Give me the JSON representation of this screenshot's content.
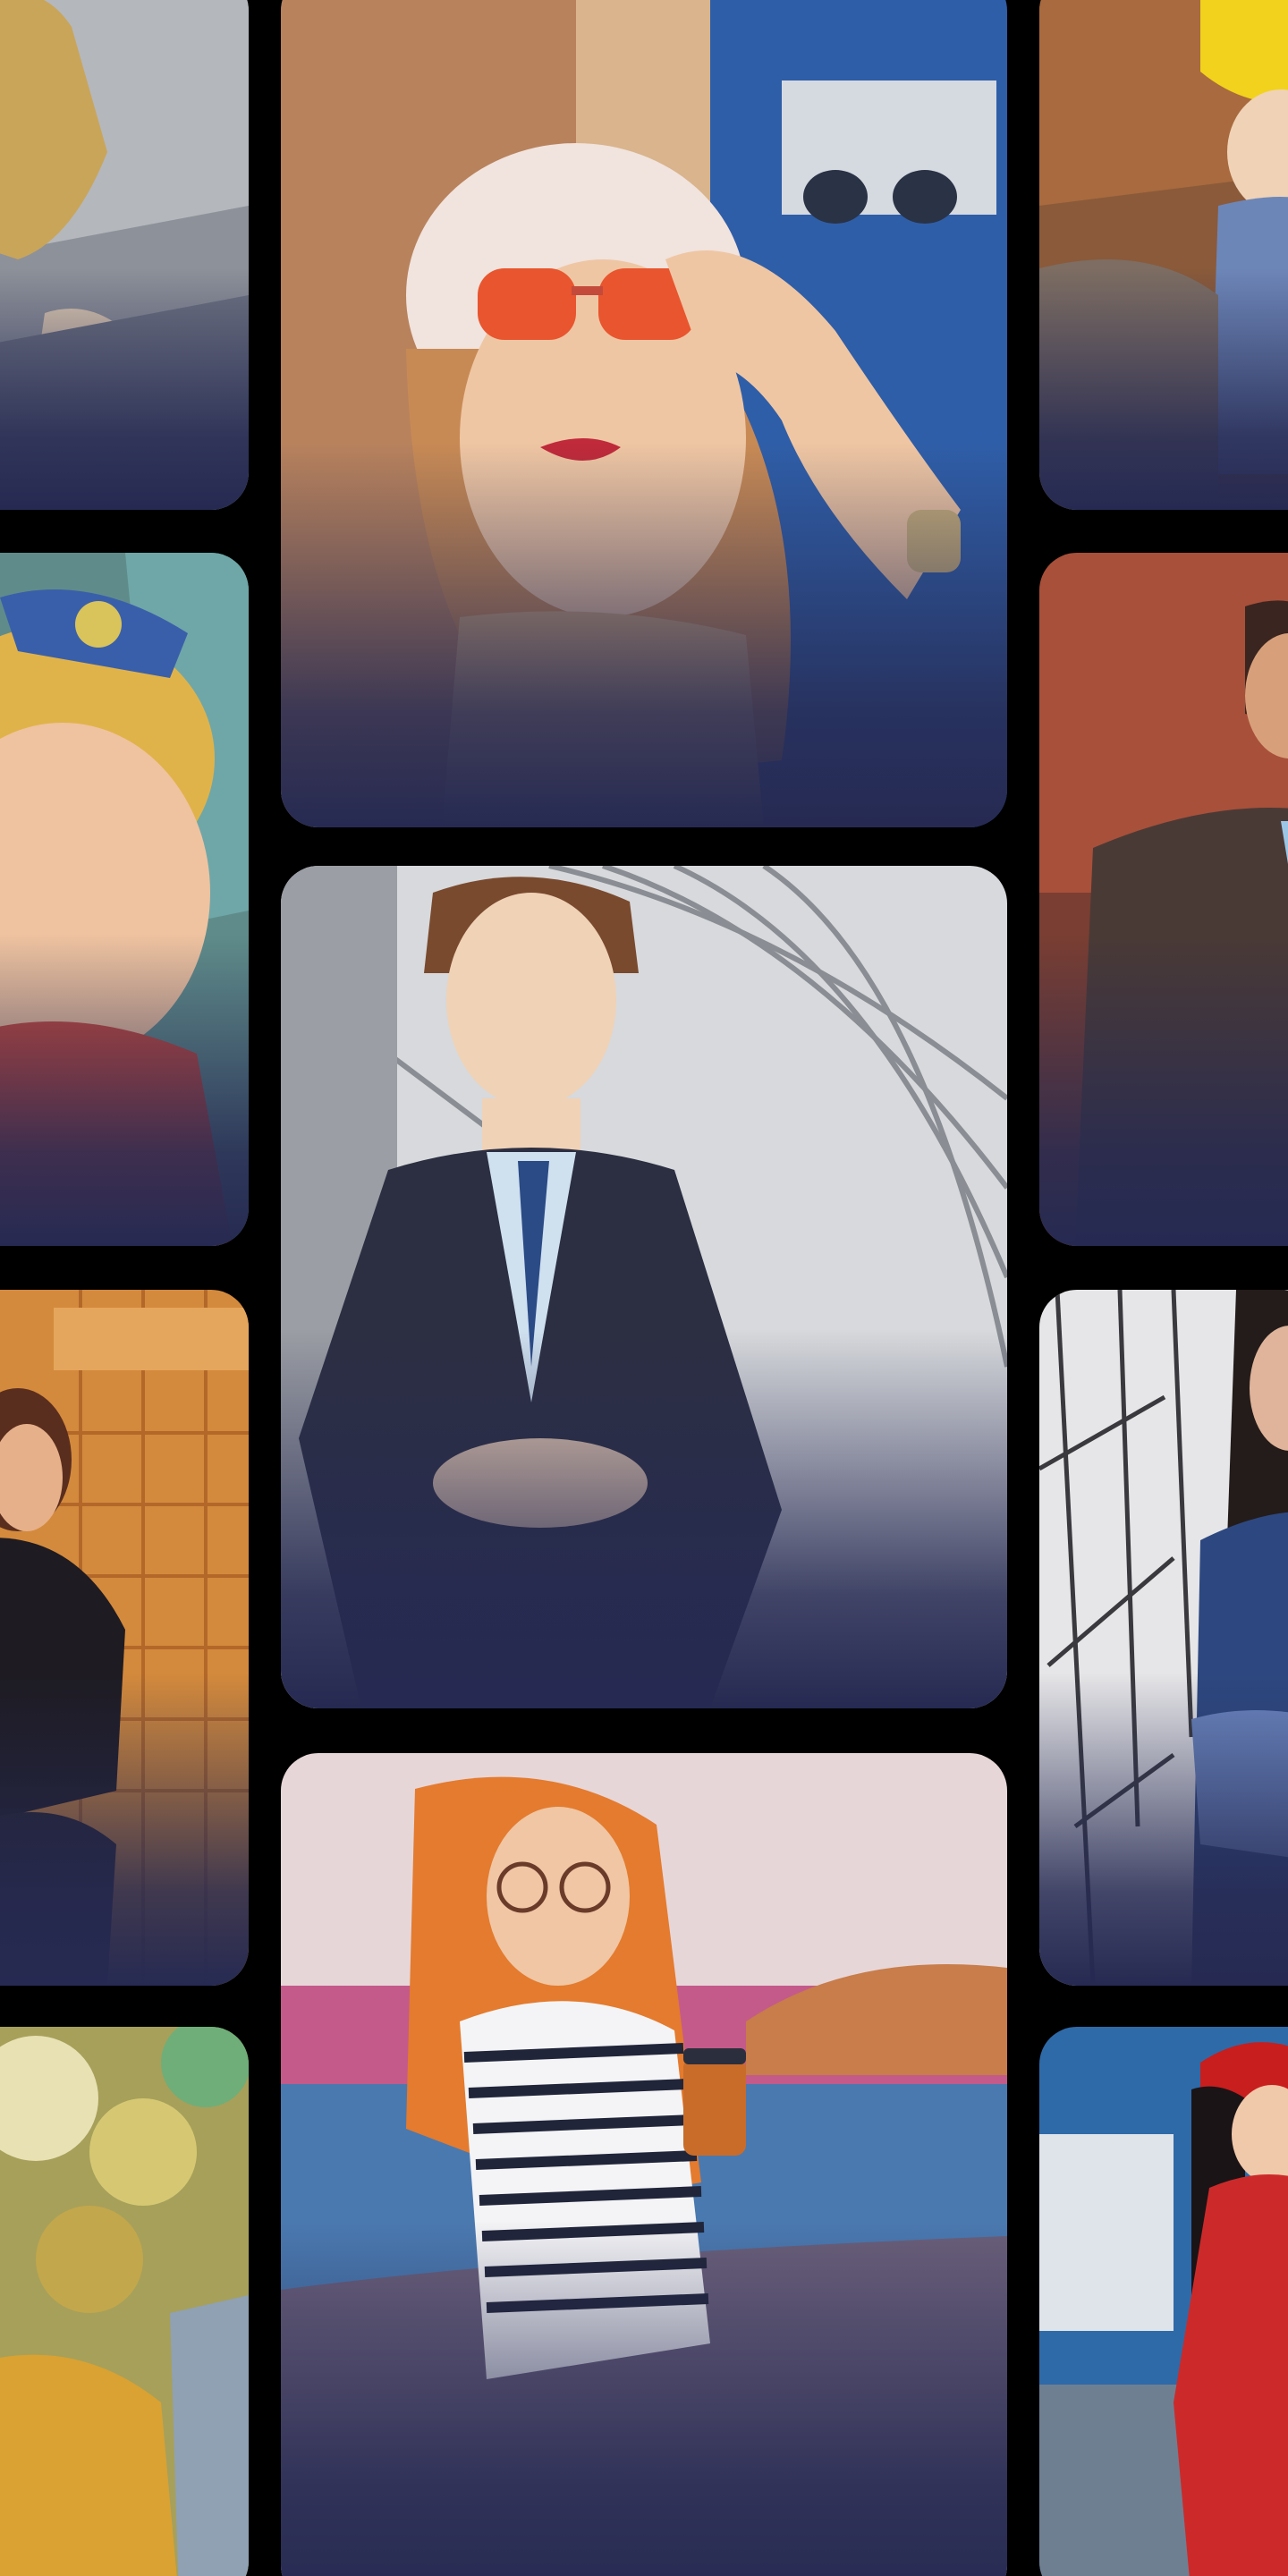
{
  "gallery": {
    "title": "",
    "columns": [
      {
        "column": "left",
        "cards": [
          {
            "subject": "child-in-yellow-sketch",
            "style": "pencil-sketch"
          },
          {
            "subject": "smiling-toddler-with-bow",
            "style": "painting"
          },
          {
            "subject": "woman-in-leather-jacket",
            "style": "cartoon"
          },
          {
            "subject": "person-in-yellow-coat",
            "style": "painting"
          }
        ]
      },
      {
        "column": "center",
        "cards": [
          {
            "subject": "woman-in-beret-with-sunglasses",
            "style": "cartoon"
          },
          {
            "subject": "man-in-suit-in-tunnel",
            "style": "pencil-sketch"
          },
          {
            "subject": "woman-in-striped-sweater-with-coffee",
            "style": "vivid-painting"
          }
        ]
      },
      {
        "column": "right",
        "cards": [
          {
            "subject": "child-with-yellow-hat",
            "style": "painting"
          },
          {
            "subject": "man-in-brown-blazer",
            "style": "cartoon"
          },
          {
            "subject": "man-with-beard-outdoors",
            "style": "sketch"
          },
          {
            "subject": "girl-in-red-dress",
            "style": "cartoon"
          }
        ]
      }
    ],
    "colors": {
      "background": "#000000",
      "card_fade": "#262a52"
    }
  }
}
